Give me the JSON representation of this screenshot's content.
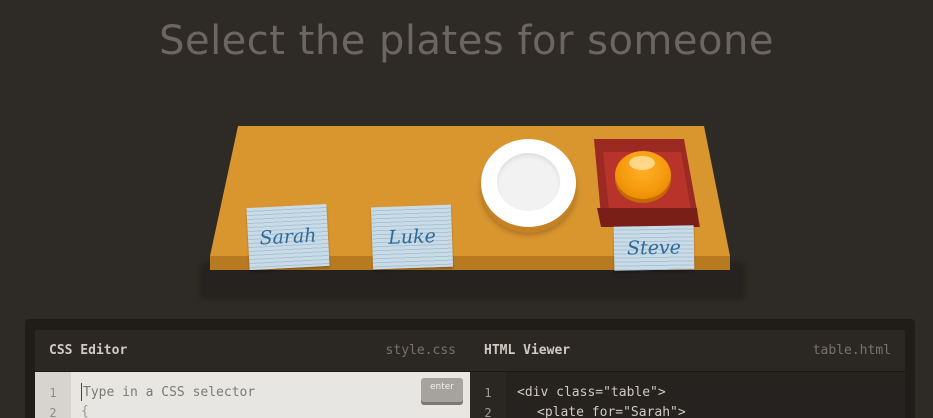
{
  "title": "Select the plates for someone",
  "scene": {
    "cards": [
      {
        "name": "Sarah"
      },
      {
        "name": "Luke"
      },
      {
        "name": "Steve"
      }
    ],
    "items": [
      "plate",
      "bento-with-orange"
    ]
  },
  "css_editor": {
    "title": "CSS Editor",
    "file": "style.css",
    "placeholder": "Type in a CSS selector",
    "line_numbers": [
      "1",
      "2"
    ],
    "line2": "{",
    "enter_label": "enter"
  },
  "html_viewer": {
    "title": "HTML Viewer",
    "file": "table.html",
    "line_numbers": [
      "1",
      "2"
    ],
    "lines": [
      "<div class=\"table\">",
      "<plate for=\"Sarah\">"
    ]
  },
  "colors": {
    "background": "#2e2a25",
    "table": "#d9962f",
    "bento": "#9b2a22",
    "orange": "#f59a0c"
  }
}
